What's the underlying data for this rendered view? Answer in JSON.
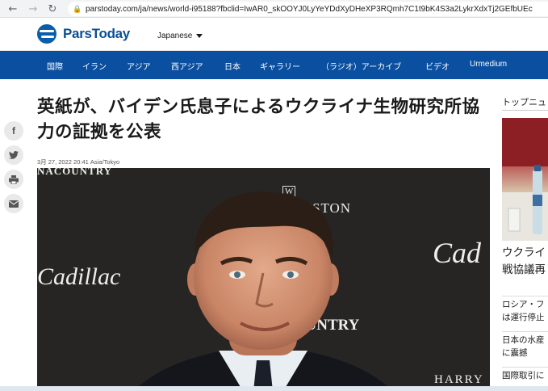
{
  "browser": {
    "url": "parstoday.com/ja/news/world-i95188?fbclid=IwAR0_skOOYJ0LyYeYDdXyDHeXP3RQmh7C1t9bK4S3a2LykrXdxTj2GEfbUEc"
  },
  "header": {
    "logo_text": "ParsToday",
    "language": "Japanese"
  },
  "nav": {
    "items": [
      "国際",
      "イラン",
      "アジア",
      "西アジア",
      "日本",
      "ギャラリー",
      "（ラジオ）アーカイブ",
      "ビデオ",
      "Urmedium"
    ]
  },
  "article": {
    "title": "英紙が、バイデン氏息子によるウクライナ生物研究所協力の証拠を公表",
    "date": "3月 27, 2022 20:41 Asia/Tokyo",
    "photo_brands": {
      "top_left": "NACOUNTRY",
      "winston": "WINSTON",
      "cadillac_left": "Cadillac",
      "cadillac_right": "Cad",
      "country": "COUNTRY",
      "harry": "HARRY"
    }
  },
  "share": {
    "icons": [
      "facebook-icon",
      "twitter-icon",
      "print-icon",
      "email-icon"
    ]
  },
  "sidebar": {
    "heading": "トップニュ",
    "big_title_lines": [
      "ウクライ",
      "戦協議再"
    ],
    "items": [
      {
        "lines": [
          "ロシア・フ",
          "は運行停止"
        ]
      },
      {
        "lines": [
          "日本の水産",
          "に震撼"
        ]
      },
      {
        "lines": [
          "国際取引に"
        ]
      }
    ]
  },
  "colors": {
    "nav_bg": "#0a4fa0",
    "logo": "#0a4f96"
  }
}
